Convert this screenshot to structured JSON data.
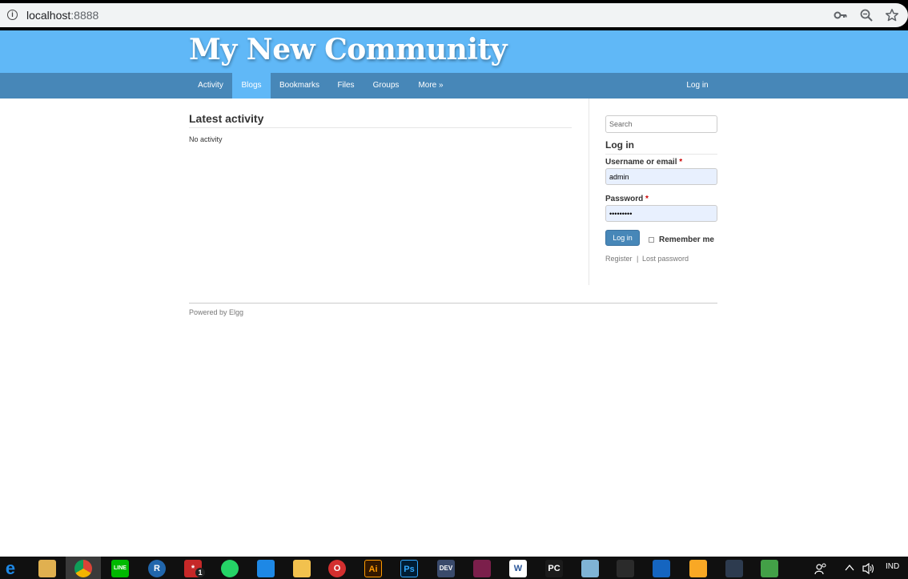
{
  "browser": {
    "url_host": "localhost",
    "url_port": ":8888",
    "icons": [
      "info-icon",
      "key-icon",
      "zoom-icon",
      "star-icon"
    ]
  },
  "site": {
    "title": "My New Community"
  },
  "nav": {
    "items": [
      {
        "label": "Activity"
      },
      {
        "label": "Blogs"
      },
      {
        "label": "Bookmarks"
      },
      {
        "label": "Files"
      },
      {
        "label": "Groups"
      },
      {
        "label": "More »"
      }
    ],
    "login": "Log in",
    "active": "Blogs"
  },
  "main": {
    "heading": "Latest activity",
    "empty_text": "No activity"
  },
  "sidebar": {
    "search_placeholder": "Search",
    "login_heading": "Log in",
    "username_label": "Username or email",
    "username_value": "admin",
    "password_label": "Password",
    "password_value": "•••••••••",
    "required_mark": "*",
    "login_button": "Log in",
    "remember_label": "Remember me",
    "register_link": "Register",
    "separator": "|",
    "lost_password_link": "Lost password"
  },
  "footer": {
    "text": "Powered by Elgg"
  },
  "taskbar": {
    "apps": [
      {
        "icon": "edge-icon",
        "glyph": "e",
        "color": "#1e88e5"
      },
      {
        "icon": "paint-icon",
        "glyph": "",
        "color": "#e0b050"
      },
      {
        "icon": "chrome-icon",
        "glyph": "",
        "color": "#3a3a3a"
      },
      {
        "icon": "line-icon",
        "glyph": "LINE",
        "color": "#00b900"
      },
      {
        "icon": "r-icon",
        "glyph": "R",
        "color": "#2166ac"
      },
      {
        "icon": "snagit-icon",
        "glyph": "*",
        "color": "#c62828"
      },
      {
        "icon": "whatsapp-icon",
        "glyph": "",
        "color": "#25d366"
      },
      {
        "icon": "vscode-icon",
        "glyph": "",
        "color": "#1e88e5"
      },
      {
        "icon": "folder-icon",
        "glyph": "",
        "color": "#f2c14e"
      },
      {
        "icon": "opera-icon",
        "glyph": "O",
        "color": "#d32f2f"
      },
      {
        "icon": "illustrator-icon",
        "glyph": "Ai",
        "color": "#331800"
      },
      {
        "icon": "photoshop-icon",
        "glyph": "Ps",
        "color": "#001d34"
      },
      {
        "icon": "devcpp-icon",
        "glyph": "DEV",
        "color": "#3a4a6b"
      },
      {
        "icon": "winrar-icon",
        "glyph": "",
        "color": "#7b1f4b"
      },
      {
        "icon": "word-icon",
        "glyph": "W",
        "color": "#ffffff"
      },
      {
        "icon": "pycharm-icon",
        "glyph": "PC",
        "color": "#1b1b1b"
      },
      {
        "icon": "paint-palette-icon",
        "glyph": "",
        "color": "#7fb3d5"
      },
      {
        "icon": "terminal-icon",
        "glyph": "",
        "color": "#2b2b2b"
      },
      {
        "icon": "virtualbox-icon",
        "glyph": "",
        "color": "#1565c0"
      },
      {
        "icon": "codeblocks-icon",
        "glyph": "",
        "color": "#f9a825"
      },
      {
        "icon": "obs-icon",
        "glyph": "",
        "color": "#2d3b4f"
      },
      {
        "icon": "git-icon",
        "glyph": "",
        "color": "#43a047"
      }
    ],
    "snagit_badge": "1",
    "language": "IND"
  }
}
